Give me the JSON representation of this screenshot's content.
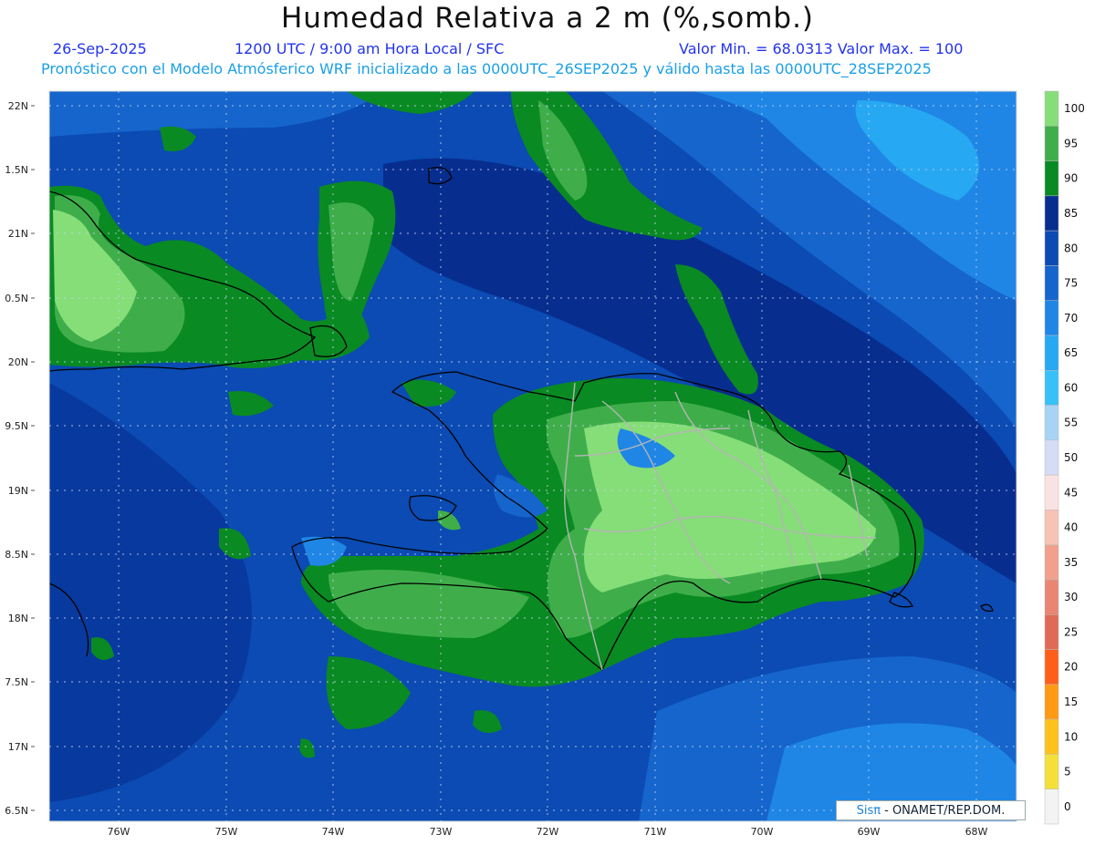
{
  "header": {
    "title": "Humedad Relativa a 2 m (%,somb.)",
    "date": "26-Sep-2025",
    "time": "1200 UTC / 9:00 am Hora Local / SFC",
    "stats": "Valor Min. = 68.0313  Valor Max. = 100",
    "subtitle": "Pronóstico con el Modelo Atmósferico WRF inicializado a las 0000UTC_26SEP2025 y válido hasta las  0000UTC_28SEP2025"
  },
  "map": {
    "lat_labels": [
      "22N",
      "1.5N",
      "21N",
      "0.5N",
      "20N",
      "9.5N",
      "19N",
      "8.5N",
      "18N",
      "7.5N",
      "17N",
      "6.5N"
    ],
    "lon_labels": [
      "76W",
      "75W",
      "74W",
      "73W",
      "72W",
      "71W",
      "70W",
      "69W",
      "68W"
    ],
    "colors": {
      "ocean_85": "#0b4bb3",
      "ocean_80": "#1565cc",
      "ocean_75": "#1f86e6",
      "rh_90": "#0a8a22",
      "rh_95": "#3fae4a",
      "rh_100": "#86de78",
      "land_outline": "#000000",
      "borders": "#b5b5b5"
    }
  },
  "colorbar": {
    "labels": [
      "100",
      "95",
      "90",
      "85",
      "80",
      "75",
      "70",
      "65",
      "60",
      "55",
      "50",
      "45",
      "40",
      "35",
      "30",
      "25",
      "20",
      "15",
      "10",
      "5",
      "0"
    ],
    "colors": [
      "#86de78",
      "#3fae4a",
      "#0a8a22",
      "#072d8f",
      "#0b4bb3",
      "#1565cc",
      "#1f86e6",
      "#27a8f2",
      "#38c1f7",
      "#a7d4f5",
      "#d4dcf6",
      "#fbe2e2",
      "#f7c4b4",
      "#f0a08d",
      "#e98673",
      "#e06a58",
      "#ff5e1a",
      "#ff9a14",
      "#ffc21c",
      "#f5e03a",
      "#f3f3f3"
    ]
  },
  "credit": {
    "logo": "Sisπ",
    "text": "- ONAMET/REP.DOM."
  }
}
